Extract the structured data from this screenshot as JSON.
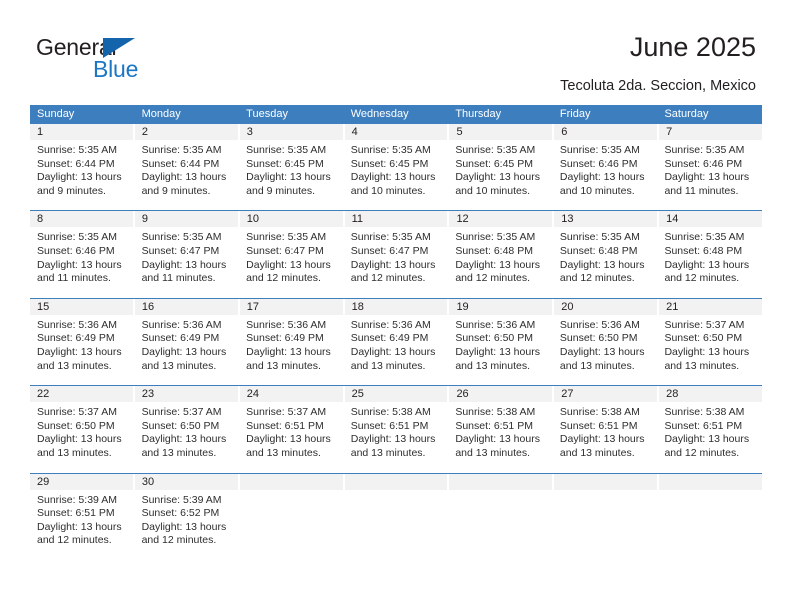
{
  "brand": {
    "name_primary": "General",
    "name_secondary": "Blue",
    "accent_color": "#1464ac",
    "secondary_color": "#1b76c4",
    "triangle_icon": "triangle-icon"
  },
  "header": {
    "title": "June 2025",
    "subtitle": "Tecoluta 2da. Seccion, Mexico"
  },
  "calendar": {
    "header_bg": "#3d7ebf",
    "daynum_bg": "#f2f2f2",
    "weekdays": [
      "Sunday",
      "Monday",
      "Tuesday",
      "Wednesday",
      "Thursday",
      "Friday",
      "Saturday"
    ],
    "weeks": [
      [
        {
          "day": "1",
          "sunrise": "Sunrise: 5:35 AM",
          "sunset": "Sunset: 6:44 PM",
          "daylight": "Daylight: 13 hours and 9 minutes."
        },
        {
          "day": "2",
          "sunrise": "Sunrise: 5:35 AM",
          "sunset": "Sunset: 6:44 PM",
          "daylight": "Daylight: 13 hours and 9 minutes."
        },
        {
          "day": "3",
          "sunrise": "Sunrise: 5:35 AM",
          "sunset": "Sunset: 6:45 PM",
          "daylight": "Daylight: 13 hours and 9 minutes."
        },
        {
          "day": "4",
          "sunrise": "Sunrise: 5:35 AM",
          "sunset": "Sunset: 6:45 PM",
          "daylight": "Daylight: 13 hours and 10 minutes."
        },
        {
          "day": "5",
          "sunrise": "Sunrise: 5:35 AM",
          "sunset": "Sunset: 6:45 PM",
          "daylight": "Daylight: 13 hours and 10 minutes."
        },
        {
          "day": "6",
          "sunrise": "Sunrise: 5:35 AM",
          "sunset": "Sunset: 6:46 PM",
          "daylight": "Daylight: 13 hours and 10 minutes."
        },
        {
          "day": "7",
          "sunrise": "Sunrise: 5:35 AM",
          "sunset": "Sunset: 6:46 PM",
          "daylight": "Daylight: 13 hours and 11 minutes."
        }
      ],
      [
        {
          "day": "8",
          "sunrise": "Sunrise: 5:35 AM",
          "sunset": "Sunset: 6:46 PM",
          "daylight": "Daylight: 13 hours and 11 minutes."
        },
        {
          "day": "9",
          "sunrise": "Sunrise: 5:35 AM",
          "sunset": "Sunset: 6:47 PM",
          "daylight": "Daylight: 13 hours and 11 minutes."
        },
        {
          "day": "10",
          "sunrise": "Sunrise: 5:35 AM",
          "sunset": "Sunset: 6:47 PM",
          "daylight": "Daylight: 13 hours and 12 minutes."
        },
        {
          "day": "11",
          "sunrise": "Sunrise: 5:35 AM",
          "sunset": "Sunset: 6:47 PM",
          "daylight": "Daylight: 13 hours and 12 minutes."
        },
        {
          "day": "12",
          "sunrise": "Sunrise: 5:35 AM",
          "sunset": "Sunset: 6:48 PM",
          "daylight": "Daylight: 13 hours and 12 minutes."
        },
        {
          "day": "13",
          "sunrise": "Sunrise: 5:35 AM",
          "sunset": "Sunset: 6:48 PM",
          "daylight": "Daylight: 13 hours and 12 minutes."
        },
        {
          "day": "14",
          "sunrise": "Sunrise: 5:35 AM",
          "sunset": "Sunset: 6:48 PM",
          "daylight": "Daylight: 13 hours and 12 minutes."
        }
      ],
      [
        {
          "day": "15",
          "sunrise": "Sunrise: 5:36 AM",
          "sunset": "Sunset: 6:49 PM",
          "daylight": "Daylight: 13 hours and 13 minutes."
        },
        {
          "day": "16",
          "sunrise": "Sunrise: 5:36 AM",
          "sunset": "Sunset: 6:49 PM",
          "daylight": "Daylight: 13 hours and 13 minutes."
        },
        {
          "day": "17",
          "sunrise": "Sunrise: 5:36 AM",
          "sunset": "Sunset: 6:49 PM",
          "daylight": "Daylight: 13 hours and 13 minutes."
        },
        {
          "day": "18",
          "sunrise": "Sunrise: 5:36 AM",
          "sunset": "Sunset: 6:49 PM",
          "daylight": "Daylight: 13 hours and 13 minutes."
        },
        {
          "day": "19",
          "sunrise": "Sunrise: 5:36 AM",
          "sunset": "Sunset: 6:50 PM",
          "daylight": "Daylight: 13 hours and 13 minutes."
        },
        {
          "day": "20",
          "sunrise": "Sunrise: 5:36 AM",
          "sunset": "Sunset: 6:50 PM",
          "daylight": "Daylight: 13 hours and 13 minutes."
        },
        {
          "day": "21",
          "sunrise": "Sunrise: 5:37 AM",
          "sunset": "Sunset: 6:50 PM",
          "daylight": "Daylight: 13 hours and 13 minutes."
        }
      ],
      [
        {
          "day": "22",
          "sunrise": "Sunrise: 5:37 AM",
          "sunset": "Sunset: 6:50 PM",
          "daylight": "Daylight: 13 hours and 13 minutes."
        },
        {
          "day": "23",
          "sunrise": "Sunrise: 5:37 AM",
          "sunset": "Sunset: 6:50 PM",
          "daylight": "Daylight: 13 hours and 13 minutes."
        },
        {
          "day": "24",
          "sunrise": "Sunrise: 5:37 AM",
          "sunset": "Sunset: 6:51 PM",
          "daylight": "Daylight: 13 hours and 13 minutes."
        },
        {
          "day": "25",
          "sunrise": "Sunrise: 5:38 AM",
          "sunset": "Sunset: 6:51 PM",
          "daylight": "Daylight: 13 hours and 13 minutes."
        },
        {
          "day": "26",
          "sunrise": "Sunrise: 5:38 AM",
          "sunset": "Sunset: 6:51 PM",
          "daylight": "Daylight: 13 hours and 13 minutes."
        },
        {
          "day": "27",
          "sunrise": "Sunrise: 5:38 AM",
          "sunset": "Sunset: 6:51 PM",
          "daylight": "Daylight: 13 hours and 13 minutes."
        },
        {
          "day": "28",
          "sunrise": "Sunrise: 5:38 AM",
          "sunset": "Sunset: 6:51 PM",
          "daylight": "Daylight: 13 hours and 12 minutes."
        }
      ],
      [
        {
          "day": "29",
          "sunrise": "Sunrise: 5:39 AM",
          "sunset": "Sunset: 6:51 PM",
          "daylight": "Daylight: 13 hours and 12 minutes."
        },
        {
          "day": "30",
          "sunrise": "Sunrise: 5:39 AM",
          "sunset": "Sunset: 6:52 PM",
          "daylight": "Daylight: 13 hours and 12 minutes."
        },
        {
          "day": "",
          "sunrise": "",
          "sunset": "",
          "daylight": ""
        },
        {
          "day": "",
          "sunrise": "",
          "sunset": "",
          "daylight": ""
        },
        {
          "day": "",
          "sunrise": "",
          "sunset": "",
          "daylight": ""
        },
        {
          "day": "",
          "sunrise": "",
          "sunset": "",
          "daylight": ""
        },
        {
          "day": "",
          "sunrise": "",
          "sunset": "",
          "daylight": ""
        }
      ]
    ]
  }
}
